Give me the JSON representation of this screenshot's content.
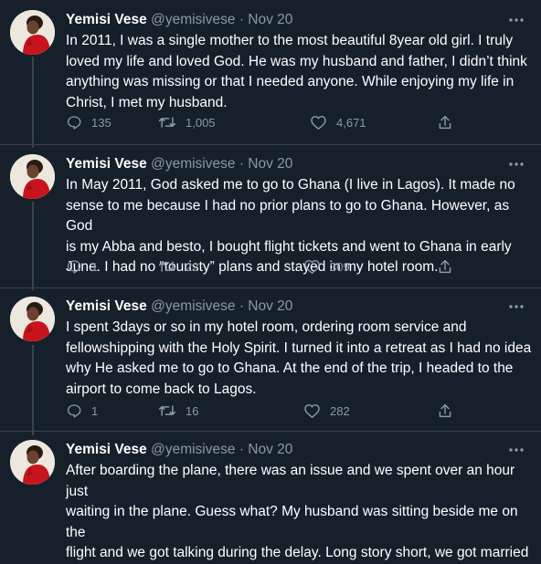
{
  "colors": {
    "background": "#15202b",
    "text": "#ffffff",
    "muted": "#8b98a5",
    "divider": "#38444d"
  },
  "tweets": [
    {
      "name": "Yemisi Vese",
      "handle": "@yemisivese",
      "dot": "·",
      "date": "Nov 20",
      "text": "In 2011, I was a single mother to the most beautiful 8year old girl. I truly\nloved my life and loved God. He was my husband and father, I didn’t think\nanything was missing or that I needed anyone. While enjoying my life in\nChrist, I met my husband.",
      "replies": "135",
      "retweets": "1,005",
      "likes": "4,671"
    },
    {
      "name": "Yemisi Vese",
      "handle": "@yemisivese",
      "dot": "·",
      "date": "Nov 20",
      "text": "In May 2011, God asked me to go to Ghana (I live in Lagos). It made no\nsense to me because I had no prior plans to go to Ghana. However, as God\nis my Abba and besto, I bought flight tickets and went to Ghana in early\nJune. I had no “touristy” plans and stayed in my hotel room.",
      "replies": "1",
      "retweets": "22",
      "likes": "309"
    },
    {
      "name": "Yemisi Vese",
      "handle": "@yemisivese",
      "dot": "·",
      "date": "Nov 20",
      "text": "I spent 3days or so in my hotel room, ordering room service and\nfellowshipping with the Holy Spirit. I turned it into a retreat as I had no idea\nwhy He asked me to go to Ghana. At the end of the trip, I headed to the\nairport to come back to Lagos.",
      "replies": "1",
      "retweets": "16",
      "likes": "282"
    },
    {
      "name": "Yemisi Vese",
      "handle": "@yemisivese",
      "dot": "·",
      "date": "Nov 20",
      "text": "After boarding the plane, there was an issue and we spent over an hour just\nwaiting in the plane. Guess what? My husband was sitting beside me on the\nflight and we got talking during the delay. Long story short, we got married"
    }
  ]
}
